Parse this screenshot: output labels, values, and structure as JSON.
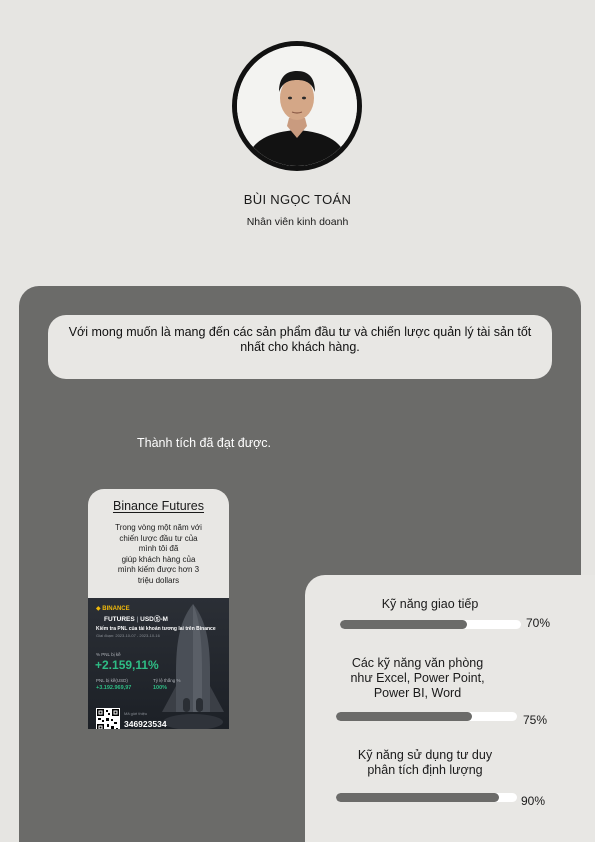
{
  "profile": {
    "name": "BÙI NGỌC TOÁN",
    "role": "Nhân viên kinh doanh"
  },
  "mission": "Với mong muốn là mang đến các sản phẩm đầu tư và chiến lược quản lý tài sản tốt nhất cho khách hàng.",
  "achievements": {
    "title": "Thành tích đã đạt được."
  },
  "binance": {
    "title": "Binance Futures",
    "description_lines": [
      "Trong vòng một năm với",
      "chiến lược đầu tư của",
      "mình tôi đã",
      "giúp khách hàng của",
      "mình kiếm được hơn 3",
      "triệu dollars"
    ],
    "poster": {
      "brand": "BINANCE",
      "product": "FUTURES",
      "market": "USDⓈ-M",
      "headline": "Kiếm tra PNL của tài khoản tương lai trên Binance",
      "period": "Giai đoạn: 2023-10-07 - 2023-10-16",
      "pnl_label": "% PNL bị kề",
      "pnl_value": "+2.159,11%",
      "pnl_usd_label": "PNL bị kề(USD)",
      "pnl_usd_value": "+3.192.969,97",
      "win_rate_label": "Tỷ lệ thắng %",
      "win_rate_value": "100%",
      "referral_label": "Mã giới thiệu",
      "referral_code": "346923534",
      "accent_color": "#f0b90b",
      "gain_color": "#2ebd85"
    }
  },
  "skills": [
    {
      "label_lines": [
        "Kỹ năng giao tiếp"
      ],
      "percent_label": "70%",
      "level": 0.7
    },
    {
      "label_lines": [
        "Các kỹ năng văn phòng",
        "như Excel, Power Point,",
        "Power BI, Word"
      ],
      "percent_label": "75%",
      "level": 0.75
    },
    {
      "label_lines": [
        "Kỹ năng sử dụng tư duy",
        "phân tích định lượng"
      ],
      "percent_label": "90%",
      "level": 0.9
    }
  ]
}
